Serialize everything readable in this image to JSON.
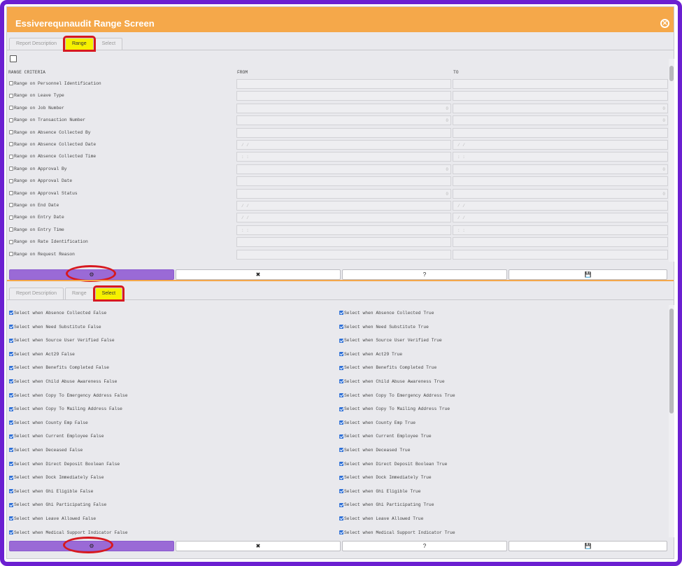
{
  "window": {
    "title": "Essiverequnaudit Range Screen",
    "close_icon": "close-circle-icon"
  },
  "range_tabs": [
    "Report Description",
    "Range",
    "Select"
  ],
  "range_active_tab": "Range",
  "range_header": {
    "criteria": "RANGE CRITERIA",
    "from": "FROM",
    "to": "TO"
  },
  "range_rows": [
    {
      "label": "Range on Personnel Identification",
      "from": "",
      "to": ""
    },
    {
      "label": "Range on Leave Type",
      "from": "",
      "to": ""
    },
    {
      "label": "Range on Job Number",
      "from": "0",
      "to": "0"
    },
    {
      "label": "Range on Transaction Number",
      "from": "0",
      "to": "0"
    },
    {
      "label": "Range on Absence Collected By",
      "from": "",
      "to": ""
    },
    {
      "label": "Range on Absence Collected Date",
      "from": "/ /",
      "to": "/ /"
    },
    {
      "label": "Range on Absence Collected Time",
      "from": ": :",
      "to": ": :"
    },
    {
      "label": "Range on Approval By",
      "from": "0",
      "to": "0"
    },
    {
      "label": "Range on Approval Date",
      "from": "",
      "to": ""
    },
    {
      "label": "Range on Approval Status",
      "from": "0",
      "to": "0"
    },
    {
      "label": "Range on End Date",
      "from": "/ /",
      "to": "/ /"
    },
    {
      "label": "Range on Entry Date",
      "from": "/ /",
      "to": "/ /"
    },
    {
      "label": "Range on Entry Time",
      "from": ": :",
      "to": ": :"
    },
    {
      "label": "Range on Rate Identification",
      "from": "",
      "to": ""
    },
    {
      "label": "Range on Request Reason",
      "from": "",
      "to": ""
    }
  ],
  "buttons": {
    "run": "⚙",
    "cancel": "✖",
    "help": "?",
    "save": "💾"
  },
  "select_tabs": [
    "Report Description",
    "Range",
    "Select"
  ],
  "select_active_tab": "Select",
  "select_left": [
    "Select when Absence Collected False",
    "Select when Need Substitute False",
    "Select when Source User Verified False",
    "Select when Act29 False",
    "Select when Benefits Completed False",
    "Select when Child Abuse Awareness False",
    "Select when Copy To Emergency Address False",
    "Select when Copy To Mailing Address False",
    "Select when County Emp False",
    "Select when Current Employee False",
    "Select when Deceased False",
    "Select when Direct Deposit Boolean False",
    "Select when Dock Immediately False",
    "Select when Ghi Eligible False",
    "Select when Ghi Participating False",
    "Select when Leave Allowed False",
    "Select when Medical Support Indicator False"
  ],
  "select_right": [
    "Select when Absence Collected True",
    "Select when Need Substitute True",
    "Select when Source User Verified True",
    "Select when Act29 True",
    "Select when Benefits Completed True",
    "Select when Child Abuse Awareness True",
    "Select when Copy To Emergency Address True",
    "Select when Copy To Mailing Address True",
    "Select when County Emp True",
    "Select when Current Employee True",
    "Select when Deceased True",
    "Select when Direct Deposit Boolean True",
    "Select when Dock Immediately True",
    "Select when Ghi Eligible True",
    "Select when Ghi Participating True",
    "Select when Leave Allowed True",
    "Select when Medical Support Indicator True"
  ],
  "colors": {
    "frame": "#6b1fd1",
    "titlebar": "#f5a84a",
    "primary_button": "#9a6ad6",
    "highlight": "#f6f000",
    "annotation": "#d7191f"
  }
}
